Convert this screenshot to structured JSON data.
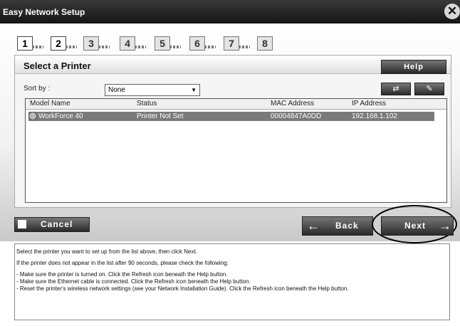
{
  "window": {
    "title": "Easy Network Setup"
  },
  "steps": [
    {
      "number": "1",
      "active": true
    },
    {
      "number": "2",
      "active": true
    },
    {
      "number": "3",
      "active": false
    },
    {
      "number": "4",
      "active": false
    },
    {
      "number": "5",
      "active": false
    },
    {
      "number": "6",
      "active": false
    },
    {
      "number": "7",
      "active": false
    },
    {
      "number": "8",
      "active": false
    }
  ],
  "panel": {
    "title": "Select a Printer",
    "help_label": "Help",
    "sort_label": "Sort by :",
    "sort_value": "None"
  },
  "table": {
    "columns": [
      "Model Name",
      "Status",
      "MAC Address",
      "IP Address"
    ],
    "rows": [
      {
        "model": "WorkForce 40",
        "status": "Printer Not Set",
        "mac": "00004847A0DD",
        "ip": "192.168.1.102",
        "selected": true
      }
    ]
  },
  "buttons": {
    "cancel": "Cancel",
    "back": "Back",
    "next": "Next"
  },
  "info": {
    "line1": "Select the printer you want to set up from the list above, then click Next.",
    "line2": "If the printer does not appear in the list after 90 seconds, please check the following:",
    "bullet1": "- Make sure the printer is turned on. Click the Refresh icon beneath the Help button.",
    "bullet2": "- Make sure the Ethernet cable is connected. Click the Refresh icon beneath the Help button.",
    "bullet3": "- Reset the printer's wireless network settings (see your Network Installation Guide). Click the Refresh icon beneath the Help button."
  },
  "icons": {
    "close": "close-icon",
    "refresh": "refresh-icon",
    "ip_settings": "ip-settings-icon",
    "printer": "printer-icon",
    "back_arrow": "arrow-left-icon",
    "next_arrow": "arrow-right-icon"
  }
}
